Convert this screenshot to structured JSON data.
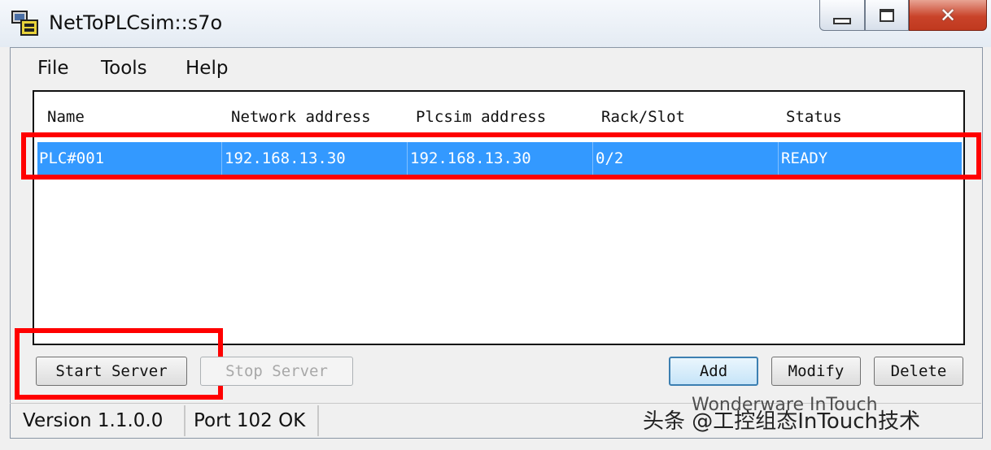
{
  "window": {
    "title": "NetToPLCsim::s7o",
    "close_glyph": "✕"
  },
  "menu": {
    "items": [
      "File",
      "Tools",
      "Help"
    ]
  },
  "list": {
    "columns": [
      "Name",
      "Network address",
      "Plcsim address",
      "Rack/Slot",
      "Status"
    ],
    "rows": [
      {
        "name": "PLC#001",
        "network_address": "192.168.13.30",
        "plcsim_address": "192.168.13.30",
        "rack_slot": "0/2",
        "status": "READY"
      }
    ],
    "selected_row_color": "#3399ff"
  },
  "buttons": {
    "start_server": "Start Server",
    "stop_server": "Stop Server",
    "add": "Add",
    "modify": "Modify",
    "delete": "Delete"
  },
  "statusbar": {
    "version": "Version 1.1.0.0",
    "port": "Port 102 OK"
  },
  "watermark": {
    "line1": "Wonderware InTouch",
    "line2": "头条 @工控组态InTouch技术"
  },
  "colors": {
    "highlight": "#ff0000",
    "selection": "#3399ff"
  },
  "icons": [
    "app-icon",
    "minimize-icon",
    "maximize-icon",
    "close-icon"
  ]
}
